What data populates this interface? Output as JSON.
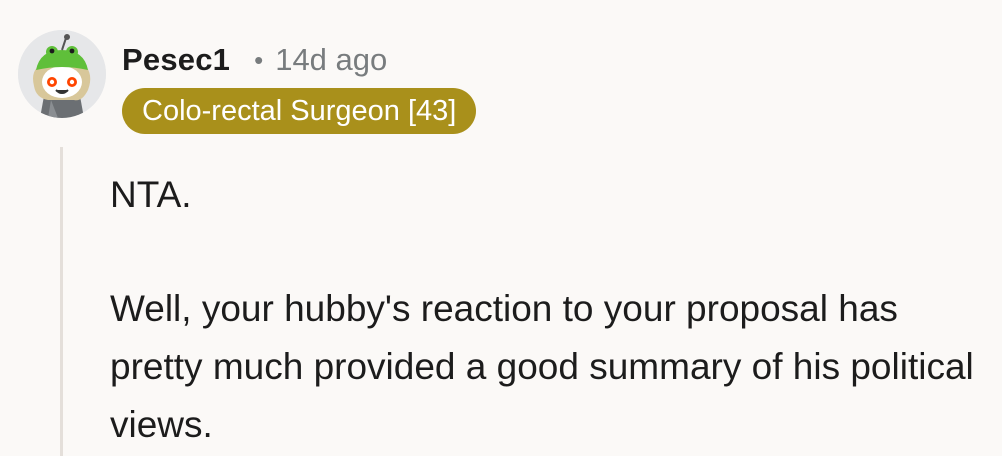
{
  "comment": {
    "author": "Pesec1",
    "separator": "•",
    "time_ago": "14d ago",
    "flair": "Colo-rectal Surgeon [43]",
    "paragraphs": [
      "NTA.",
      "Well, your hubby's reaction to your proposal has pretty much provided a good summary of his political views."
    ]
  },
  "colors": {
    "background": "#fbf9f7",
    "flair_background": "#a9901b",
    "flair_text": "#ffffff",
    "meta_text": "#787c7e",
    "thread_line": "#e4dfda"
  },
  "icons": {
    "avatar": "user-avatar-snoo-frog-hat"
  }
}
